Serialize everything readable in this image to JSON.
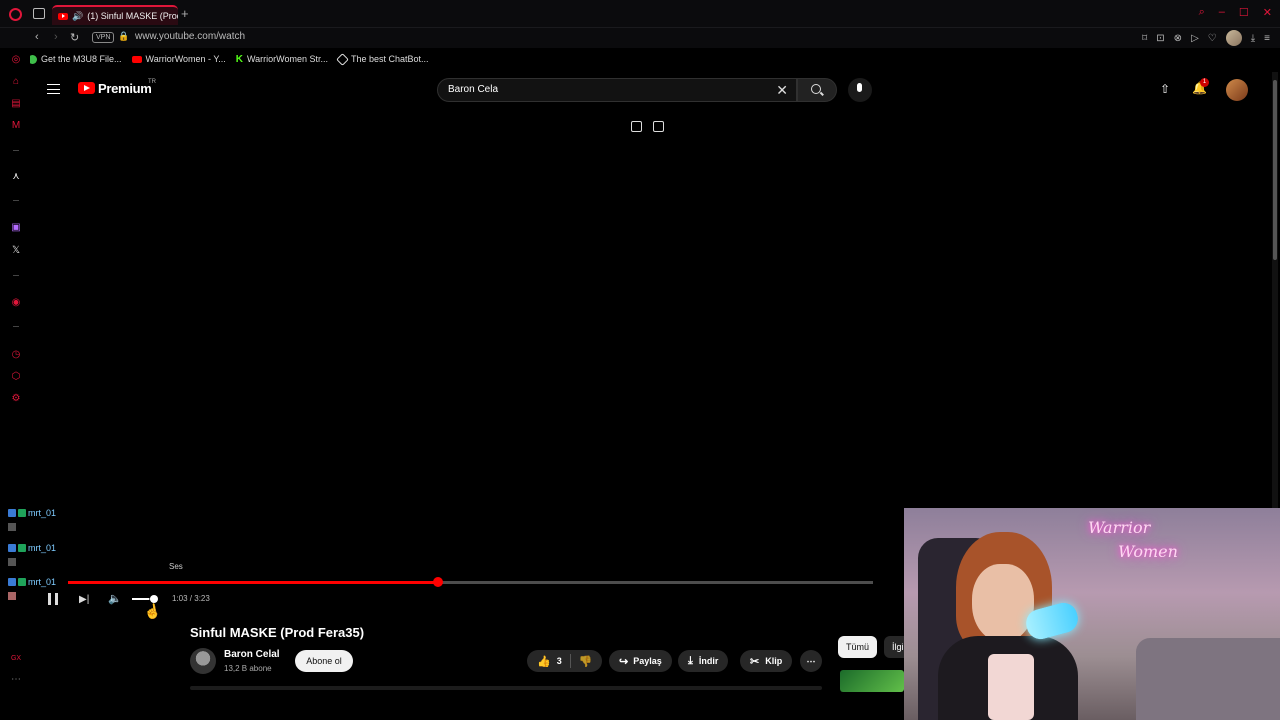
{
  "browser": {
    "tab_title": "(1) Sinful MASKE (Prod",
    "url": "www.youtube.com/watch",
    "vpn_label": "VPN",
    "bookmarks": [
      {
        "label": "Get the M3U8 File...",
        "icon": "green-dot-icon"
      },
      {
        "label": "WarriorWomen - Y...",
        "icon": "youtube-icon"
      },
      {
        "label": "WarriorWomen Str...",
        "icon": "kick-icon"
      },
      {
        "label": "The best ChatBot...",
        "icon": "chatgpt-icon"
      }
    ],
    "accent_color": "#e0163a"
  },
  "masthead": {
    "logo_text": "Premium",
    "region": "TR",
    "search_value": "Baron Cela",
    "notification_count": "1"
  },
  "player": {
    "tooltip": "Ses",
    "time": "1:03 / 3:23",
    "progress": 0.46,
    "volume": 0.7
  },
  "chat_overlay": [
    {
      "user": "mrt_01"
    },
    {
      "user": "mrt_01"
    },
    {
      "user": "mrt_01"
    }
  ],
  "video": {
    "title": "Sinful MASKE (Prod Fera35)",
    "channel": "Baron Celal",
    "subscribers": "13,2 B abone",
    "subscribe_label": "Abone ol",
    "like_count": "3",
    "share_label": "Paylaş",
    "download_label": "İndir",
    "clip_label": "Klip"
  },
  "chips": [
    {
      "label": "Tümü"
    },
    {
      "label": "İlgi"
    }
  ],
  "webcam": {
    "neon_line1": "Warrior",
    "neon_line2": "Women"
  }
}
